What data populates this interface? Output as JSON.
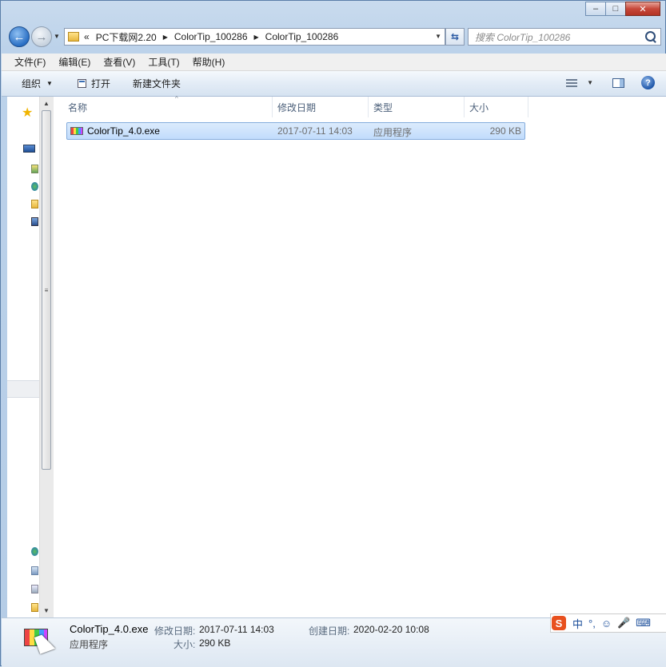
{
  "window": {
    "minimize_label": "▭",
    "maximize_label": "□",
    "close_label": "✕"
  },
  "nav": {
    "address": {
      "overflow": "«",
      "crumbs": [
        "PC下载网2.20",
        "ColorTip_100286",
        "ColorTip_100286"
      ]
    },
    "search_placeholder": "搜索 ColorTip_100286"
  },
  "menu": [
    "文件(F)",
    "编辑(E)",
    "查看(V)",
    "工具(T)",
    "帮助(H)"
  ],
  "toolbar": {
    "organize": "组织",
    "open": "打开",
    "new_folder": "新建文件夹"
  },
  "columns": [
    "名称",
    "修改日期",
    "类型",
    "大小"
  ],
  "files": [
    {
      "name": "ColorTip_4.0.exe",
      "modified": "2017-07-11 14:03",
      "type": "应用程序",
      "size": "290 KB"
    }
  ],
  "details": {
    "name": "ColorTip_4.0.exe",
    "kind": "应用程序",
    "modified_label": "修改日期:",
    "modified_value": "2017-07-11 14:03",
    "created_label": "创建日期:",
    "created_value": "2020-02-20 10:08",
    "size_label": "大小:",
    "size_value": "290 KB"
  },
  "ime": {
    "logo": "S",
    "mode": "中",
    "punct": "°,",
    "emoji": "☺",
    "voice": "🎤",
    "keyboard": "⌨"
  },
  "colors": {
    "selection": "#c9e0fc",
    "selection_border": "#84acdd",
    "header_text": "#4c607a",
    "ime_logo": "#e8501e"
  }
}
